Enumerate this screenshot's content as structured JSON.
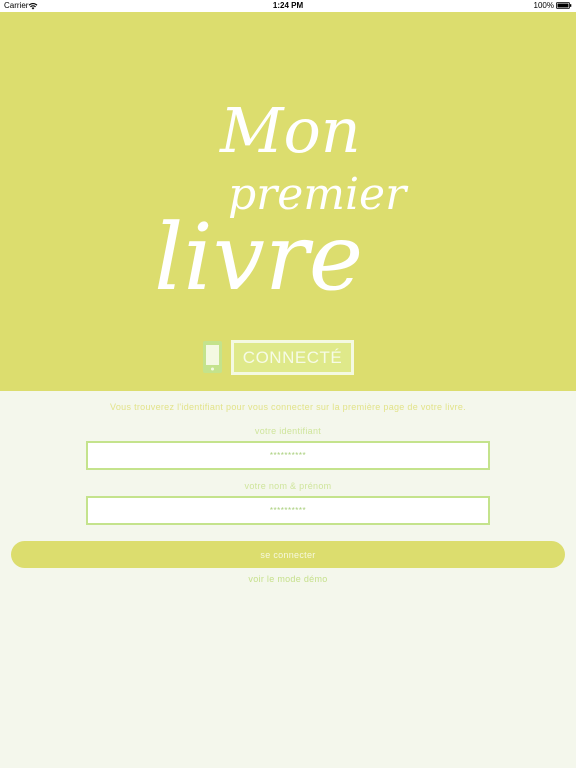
{
  "status_bar": {
    "carrier": "Carrier",
    "time": "1:24 PM",
    "battery": "100%",
    "icons": [
      "wifi-icon",
      "battery-icon"
    ]
  },
  "logo": {
    "line1": "Mon",
    "line2": "premier",
    "line3": "livre"
  },
  "connection": {
    "icon": "phone-icon",
    "label": "CONNECTÉ"
  },
  "login": {
    "info": "Vous trouverez l'identifiant pour vous connecter sur la première page de votre livre.",
    "id_label": "votre identifiant",
    "id_value": "**********",
    "name_label": "votre nom & prénom",
    "name_value": "**********",
    "submit_label": "se connecter",
    "demo_link": "voir le mode démo"
  },
  "colors": {
    "hero": "#dcdd6e",
    "background": "#f4f7ec",
    "accent_green": "#c4e38c"
  }
}
